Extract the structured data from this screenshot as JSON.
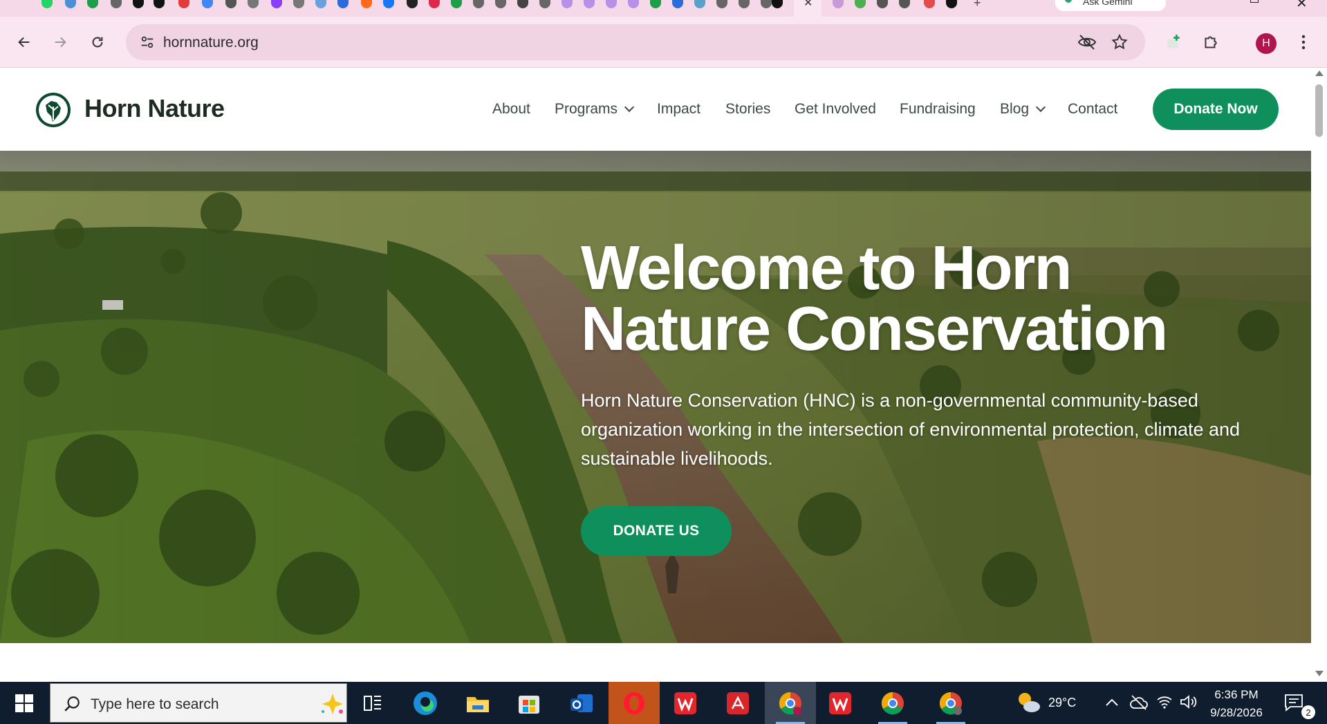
{
  "browser": {
    "url": "hornnature.org",
    "gemini_label": "Ask Gemini",
    "profile_initial": "H"
  },
  "site": {
    "brand": "Horn Nature",
    "nav": [
      {
        "label": "About"
      },
      {
        "label": "Programs",
        "dropdown": true
      },
      {
        "label": "Impact"
      },
      {
        "label": "Stories"
      },
      {
        "label": "Get Involved"
      },
      {
        "label": "Fundraising"
      },
      {
        "label": "Blog",
        "dropdown": true
      },
      {
        "label": "Contact"
      }
    ],
    "donate_now": "Donate Now"
  },
  "hero": {
    "title_line1": "Welcome to Horn",
    "title_line2": "Nature Conservation",
    "description": "Horn Nature Conservation (HNC) is a non-governmental community-based organization working in the intersection of environmental protection, climate and sustainable livelihoods.",
    "cta": "DONATE US"
  },
  "taskbar": {
    "search_placeholder": "Type here to search",
    "weather": "29°C",
    "time": "6:36 PM",
    "date": "9/28/2026",
    "notifications": "2"
  },
  "colors": {
    "brand_green": "#0e8f5c",
    "browser_pink": "#f9e6f0",
    "taskbar": "#0f1d2e"
  }
}
